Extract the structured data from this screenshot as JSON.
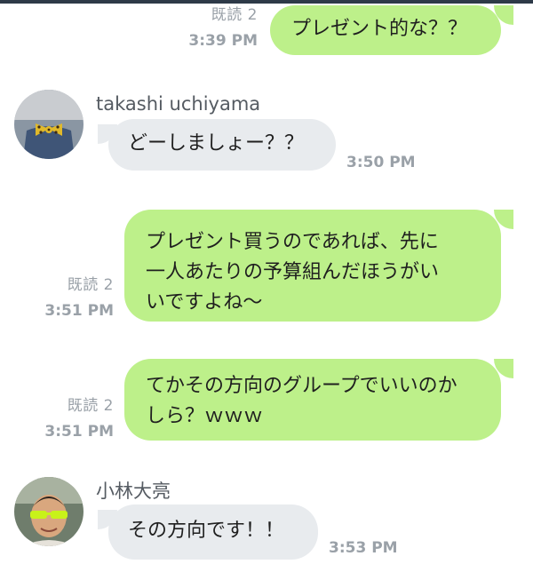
{
  "messages": [
    {
      "direction": "out",
      "text": "プレゼント的な？？",
      "read": "既読 2",
      "time": "3:39 PM"
    },
    {
      "direction": "in",
      "sender": "takashi uchiyama",
      "avatar": "avatar-takashi",
      "text": "どーしましょー？？",
      "time": "3:50 PM"
    },
    {
      "direction": "out",
      "lines": [
        "プレゼント買うのであれば、先に",
        "一人あたりの予算組んだほうがい",
        "いですよね〜"
      ],
      "read": "既読 2",
      "time": "3:51 PM"
    },
    {
      "direction": "out",
      "lines": [
        "てかその方向のグループでいいのか",
        "しら？ｗｗｗ"
      ],
      "read": "既読 2",
      "time": "3:51 PM"
    },
    {
      "direction": "in",
      "sender": "小林大亮",
      "avatar": "avatar-kobayashi",
      "text": "その方向です！！",
      "time": "3:53 PM"
    }
  ],
  "colors": {
    "outgoing_bubble": "#bdf08a",
    "incoming_bubble": "#e8ebee",
    "meta_text": "#9aa1a8"
  }
}
